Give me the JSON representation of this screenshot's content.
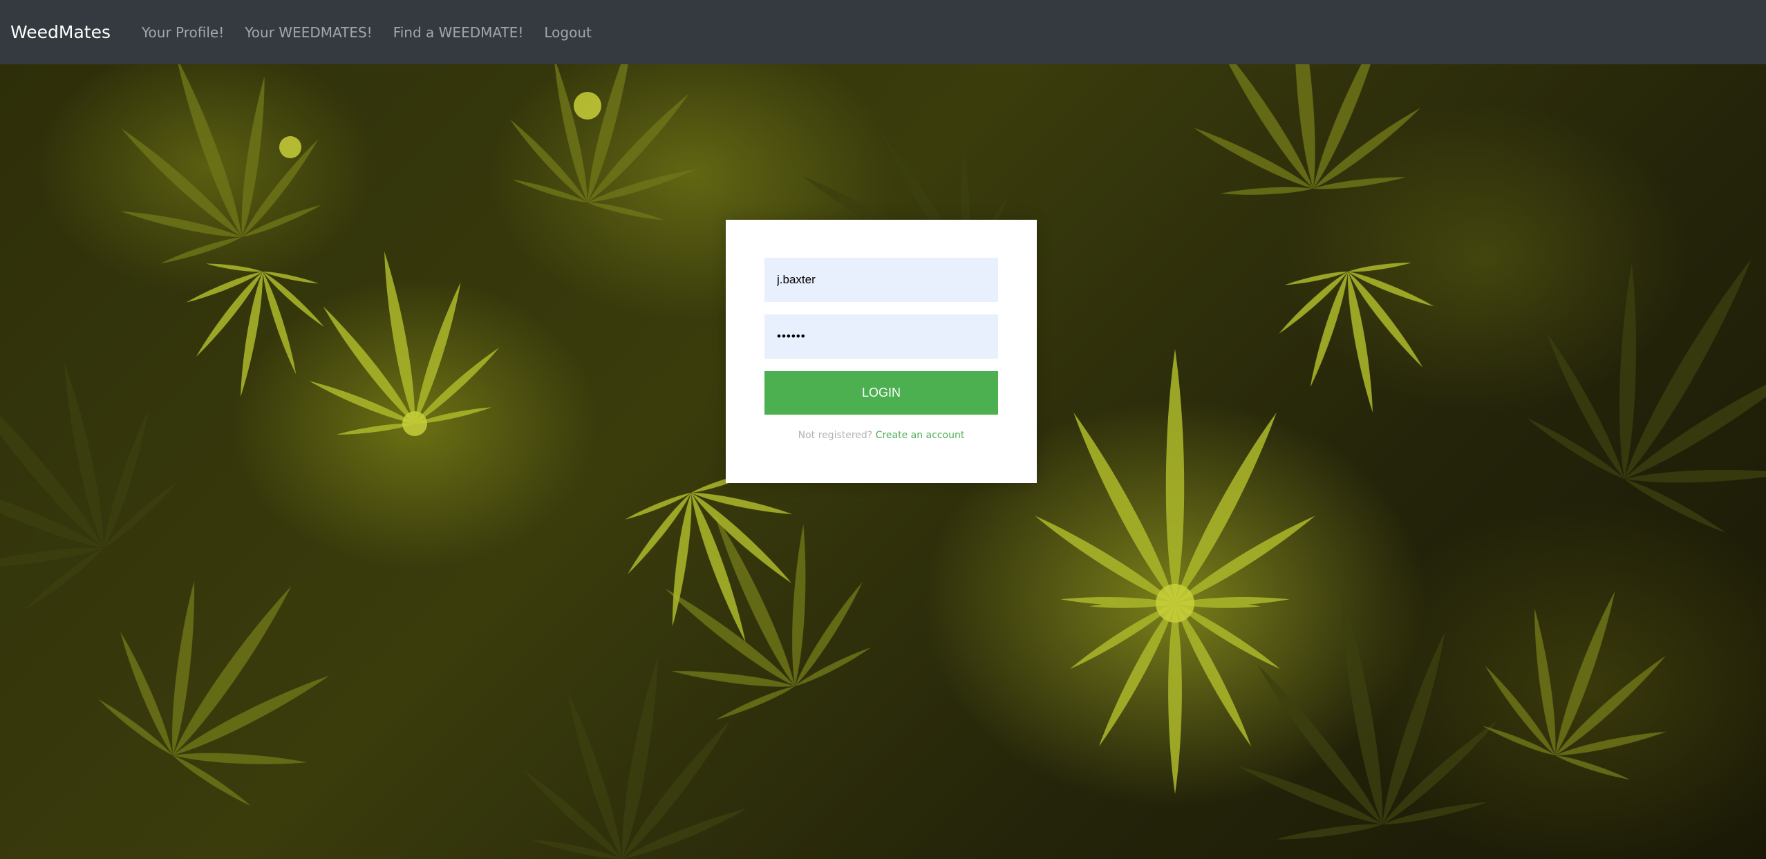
{
  "navbar": {
    "brand": "WeedMates",
    "links": [
      {
        "label": "Your Profile!"
      },
      {
        "label": "Your WEEDMATES!"
      },
      {
        "label": "Find a WEEDMATE!"
      },
      {
        "label": "Logout"
      }
    ]
  },
  "login_form": {
    "username_value": "j.baxter",
    "password_value": "••••••",
    "login_button_label": "LOGIN",
    "not_registered_text": "Not registered?",
    "create_account_link": "Create an account"
  },
  "colors": {
    "navbar_bg": "#343a40",
    "accent_green": "#4caf50",
    "input_bg": "#e8f0fe"
  }
}
